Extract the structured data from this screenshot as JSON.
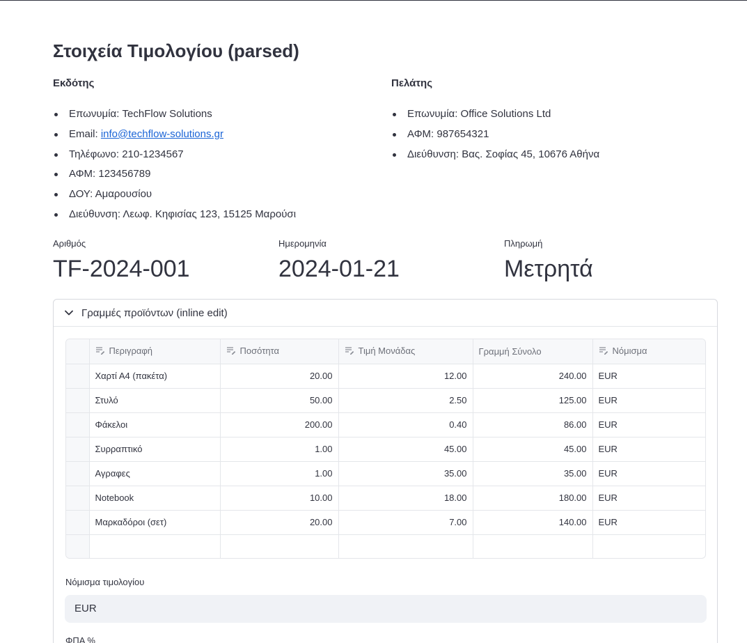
{
  "title": "Στοιχεία Τιμολογίου (parsed)",
  "issuer": {
    "heading": "Εκδότης",
    "items": [
      {
        "label": "Επωνυμία: ",
        "value": "TechFlow Solutions"
      },
      {
        "label": "Email: ",
        "value": "info@techflow-solutions.gr"
      },
      {
        "label": "Τηλέφωνο: ",
        "value": "210-1234567"
      },
      {
        "label": "ΑΦΜ: ",
        "value": "123456789"
      },
      {
        "label": "ΔΟΥ: ",
        "value": "Αμαρουσίου"
      },
      {
        "label": "Διεύθυνση: ",
        "value": "Λεωφ. Κηφισίας 123, 15125 Μαρούσι"
      }
    ]
  },
  "customer": {
    "heading": "Πελάτης",
    "items": [
      {
        "label": "Επωνυμία: ",
        "value": "Office Solutions Ltd"
      },
      {
        "label": "ΑΦΜ: ",
        "value": "987654321"
      },
      {
        "label": "Διεύθυνση: ",
        "value": "Βας. Σοφίας 45, 10676 Αθήνα"
      }
    ]
  },
  "metrics": [
    {
      "label": "Αριθμός",
      "value": "TF-2024-001"
    },
    {
      "label": "Ημερομηνία",
      "value": "2024-01-21"
    },
    {
      "label": "Πληρωμή",
      "value": "Μετρητά"
    }
  ],
  "expander": {
    "title": "Γραμμές προϊόντων (inline edit)",
    "columns": [
      "Περιγραφή",
      "Ποσότητα",
      "Τιμή Μονάδας",
      "Γραμμή Σύνολο",
      "Νόμισμα"
    ],
    "editable_columns": [
      true,
      true,
      true,
      false,
      true
    ],
    "rows": [
      [
        "Χαρτί Α4 (πακέτα)",
        "20.00",
        "12.00",
        "240.00",
        "EUR"
      ],
      [
        "Στυλό",
        "50.00",
        "2.50",
        "125.00",
        "EUR"
      ],
      [
        "Φάκελοι",
        "200.00",
        "0.40",
        "86.00",
        "EUR"
      ],
      [
        "Συρραπτικό",
        "1.00",
        "45.00",
        "45.00",
        "EUR"
      ],
      [
        "Αγραφες",
        "1.00",
        "35.00",
        "35.00",
        "EUR"
      ],
      [
        "Notebook",
        "10.00",
        "18.00",
        "180.00",
        "EUR"
      ],
      [
        "Μαρκαδόροι (σετ)",
        "20.00",
        "7.00",
        "140.00",
        "EUR"
      ]
    ],
    "invoice_currency_label": "Νόμισμα τιμολογίου",
    "invoice_currency_value": "EUR",
    "vat_label": "ΦΠΑ %"
  },
  "colors": {
    "text": "#31333f",
    "link": "#1a64d6",
    "border": "#e4e6ea",
    "input_bg": "#f0f2f6"
  }
}
